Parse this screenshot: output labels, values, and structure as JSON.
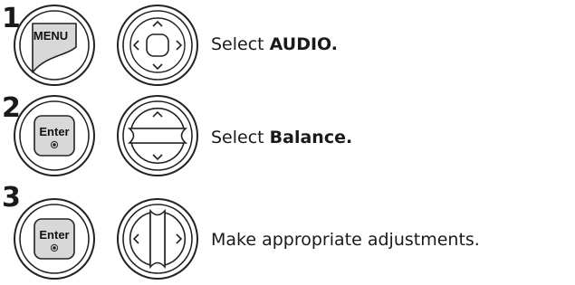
{
  "steps": [
    {
      "number": "1",
      "primary_button": {
        "label": "MENU",
        "icon": "menu-key"
      },
      "nav_button": {
        "icon": "dpad-all-directions-icon"
      },
      "caption_prefix": "Select ",
      "caption_bold": "AUDIO."
    },
    {
      "number": "2",
      "primary_button": {
        "label": "Enter",
        "icon": "enter-key"
      },
      "nav_button": {
        "icon": "dpad-up-down-icon"
      },
      "caption_prefix": "Select ",
      "caption_bold": "Balance."
    },
    {
      "number": "3",
      "primary_button": {
        "label": "Enter",
        "icon": "enter-key"
      },
      "nav_button": {
        "icon": "dpad-left-right-icon"
      },
      "caption_prefix": "Make appropriate adjustments.",
      "caption_bold": ""
    }
  ],
  "colors": {
    "key_fill": "#d8d8d8",
    "key_stroke": "#222222",
    "text": "#1a1a1a"
  }
}
